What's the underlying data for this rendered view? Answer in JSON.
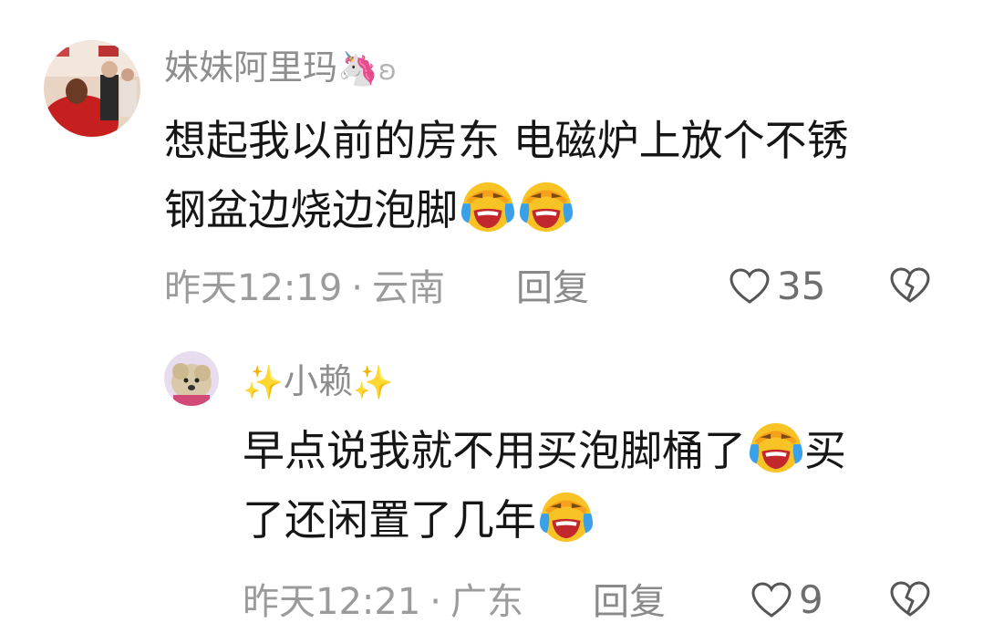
{
  "comments": [
    {
      "username": "妹妹阿里玛",
      "username_emoji": "🦄",
      "username_suffix": "ʚ",
      "lines": [
        "想起我以前的房东  电磁炉上放个不锈",
        "钢盆边烧边泡脚"
      ],
      "line2_emojis": 2,
      "time": "昨天12:19",
      "location": "云南",
      "reply_label": "回复",
      "likes": "35"
    },
    {
      "username": "小赖",
      "username_prefix_emoji": "✨",
      "username_suffix_emoji": "✨",
      "line1": "早点说我就不用买泡脚桶了",
      "line1_tail": "买",
      "line2": "了还闲置了几年",
      "time": "昨天12:21",
      "location": "广东",
      "reply_label": "回复",
      "likes": "9"
    }
  ],
  "icons": [
    "laugh-cry-emoji-icon",
    "heart-outline-icon",
    "broken-heart-icon"
  ],
  "colors": {
    "meta": "#9b9b9b",
    "text": "#161616",
    "emoji_yellow": "#f8c325",
    "emoji_blue": "#3aa0e8"
  }
}
